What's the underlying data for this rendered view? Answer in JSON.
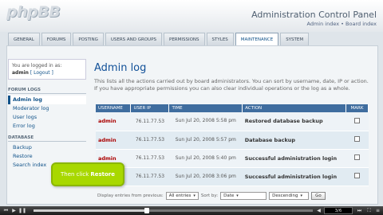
{
  "header": {
    "logo": "phpBB",
    "title": "Administration Control Panel",
    "breadcrumb_index": "Admin index",
    "breadcrumb_sep": " • ",
    "breadcrumb_board": "Board index"
  },
  "tabs": [
    {
      "label": "GENERAL"
    },
    {
      "label": "FORUMS"
    },
    {
      "label": "POSTING"
    },
    {
      "label": "USERS AND GROUPS"
    },
    {
      "label": "PERMISSIONS"
    },
    {
      "label": "STYLES"
    },
    {
      "label": "MAINTENANCE"
    },
    {
      "label": "SYSTEM"
    }
  ],
  "active_tab": "MAINTENANCE",
  "sidebar": {
    "login_text": "You are logged in as:",
    "user": "admin",
    "logout": "[ Logout ]",
    "sections": [
      {
        "heading": "FORUM LOGS",
        "items": [
          "Admin log",
          "Moderator log",
          "User logs",
          "Error log"
        ]
      },
      {
        "heading": "DATABASE",
        "items": [
          "Backup",
          "Restore",
          "Search index"
        ]
      }
    ]
  },
  "main": {
    "title": "Admin log",
    "description": "This lists all the actions carried out by board administrators. You can sort by username, date, IP or action. If you have appropriate permissions you can also clear individual operations or the log as a whole.",
    "columns": [
      "USERNAME",
      "USER IP",
      "TIME",
      "ACTION",
      "MARK"
    ],
    "rows": [
      {
        "user": "admin",
        "ip": "76.11.77.53",
        "time": "Sun Jul 20, 2008 5:58 pm",
        "action": "Restored database backup"
      },
      {
        "user": "admin",
        "ip": "76.11.77.53",
        "time": "Sun Jul 20, 2008 5:57 pm",
        "action": "Database backup"
      },
      {
        "user": "admin",
        "ip": "76.11.77.53",
        "time": "Sun Jul 20, 2008 5:40 pm",
        "action": "Successful administration login"
      },
      {
        "user": "admin",
        "ip": "76.11.77.53",
        "time": "Sun Jul 20, 2008 3:06 pm",
        "action": "Successful administration login"
      }
    ],
    "filter": {
      "label": "Display entries from previous:",
      "entries": "All entries",
      "sort_label": "Sort by:",
      "sort_value": "Date",
      "order": "Descending",
      "go": "Go"
    }
  },
  "tooltip": {
    "prefix": "Then click",
    "target": "Restore"
  },
  "player": {
    "slide": "3/6",
    "progress": 0.405
  },
  "colors": {
    "accent": "#105289",
    "table_header": "#3f6d9f",
    "username": "#aa0000",
    "tooltip": "#a8d800"
  }
}
